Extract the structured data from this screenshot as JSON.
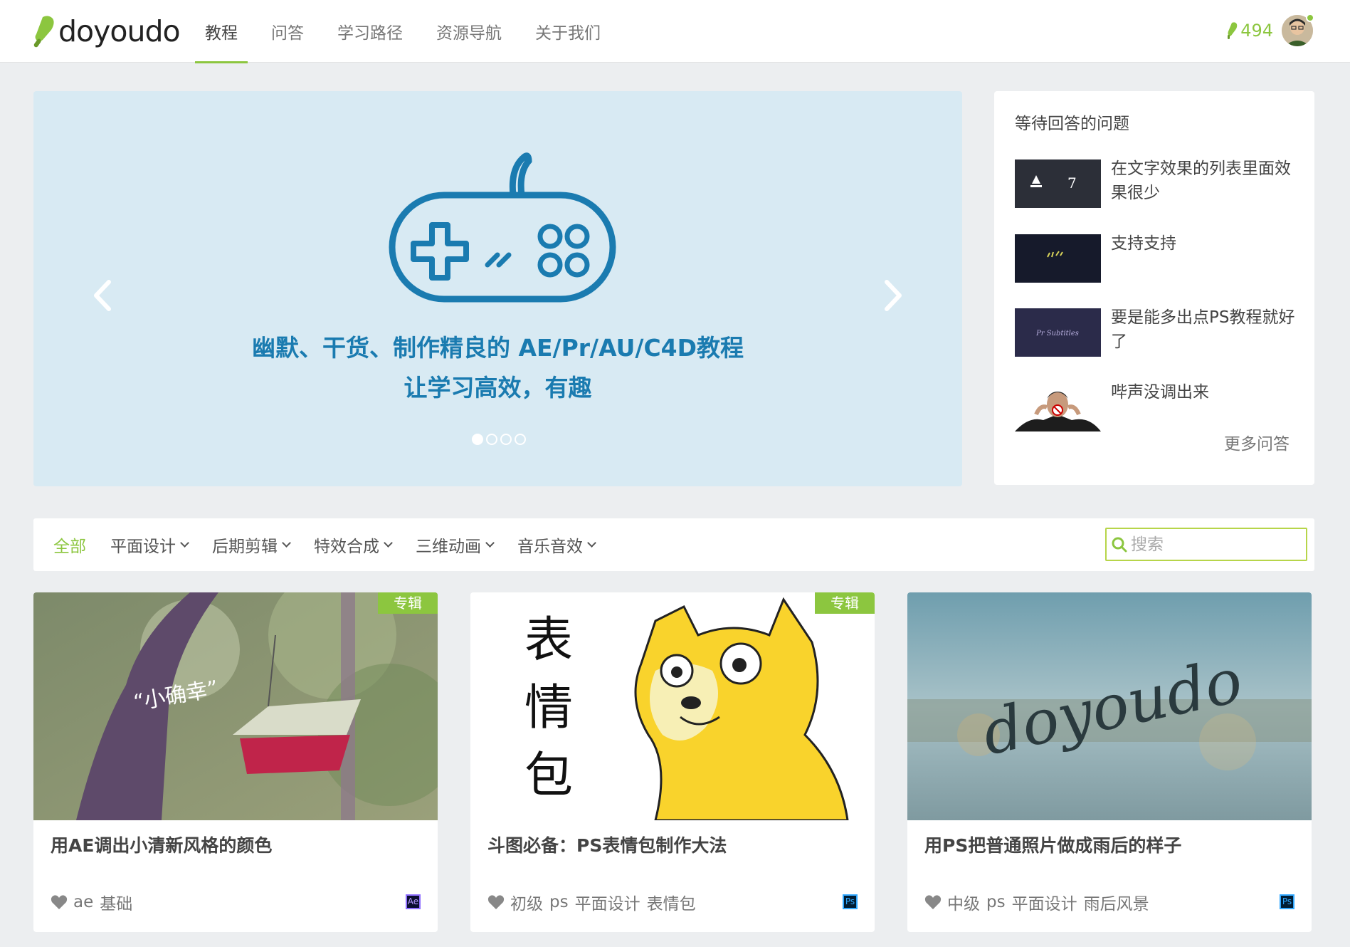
{
  "brand": {
    "name": "doyoudo",
    "accent": "#8cc63f"
  },
  "nav": {
    "items": [
      {
        "label": "教程"
      },
      {
        "label": "问答"
      },
      {
        "label": "学习路径"
      },
      {
        "label": "资源导航"
      },
      {
        "label": "关于我们"
      }
    ],
    "active_index": 0
  },
  "user": {
    "points": "494",
    "icon": "popsicle-icon"
  },
  "banner": {
    "line1": "幽默、干货、制作精良的 AE/Pr/AU/C4D教程",
    "line2": "让学习高效，有趣",
    "slide_count": 4,
    "active_slide": 1,
    "color": "#1a7bb0"
  },
  "side": {
    "title": "等待回答的问题",
    "questions": [
      {
        "text": "在文字效果的列表里面效果很少",
        "thumb_text": "7"
      },
      {
        "text": "支持支持"
      },
      {
        "text": "要是能多出点PS教程就好了",
        "thumb_text": "Pr Subtitles"
      },
      {
        "text": "哔声没调出来"
      }
    ],
    "more": "更多问答"
  },
  "filter": {
    "items": [
      {
        "label": "全部",
        "active": true
      },
      {
        "label": "平面设计"
      },
      {
        "label": "后期剪辑"
      },
      {
        "label": "特效合成"
      },
      {
        "label": "三维动画"
      },
      {
        "label": "音乐音效"
      }
    ],
    "search_placeholder": "搜索"
  },
  "cards": [
    {
      "title": "用AE调出小清新风格的颜色",
      "badge": "专辑",
      "tags": [
        "ae",
        "基础"
      ],
      "software": "Ae",
      "image_text": "“小确幸”"
    },
    {
      "title": "斗图必备：PS表情包制作大法",
      "badge": "专辑",
      "tags": [
        "初级",
        "ps",
        "平面设计",
        "表情包"
      ],
      "software": "Ps",
      "image_text": [
        "表",
        "情",
        "包"
      ]
    },
    {
      "title": "用PS把普通照片做成雨后的样子",
      "tags": [
        "中级",
        "ps",
        "平面设计",
        "雨后风景"
      ],
      "software": "Ps",
      "image_text": "doyoudo"
    }
  ]
}
